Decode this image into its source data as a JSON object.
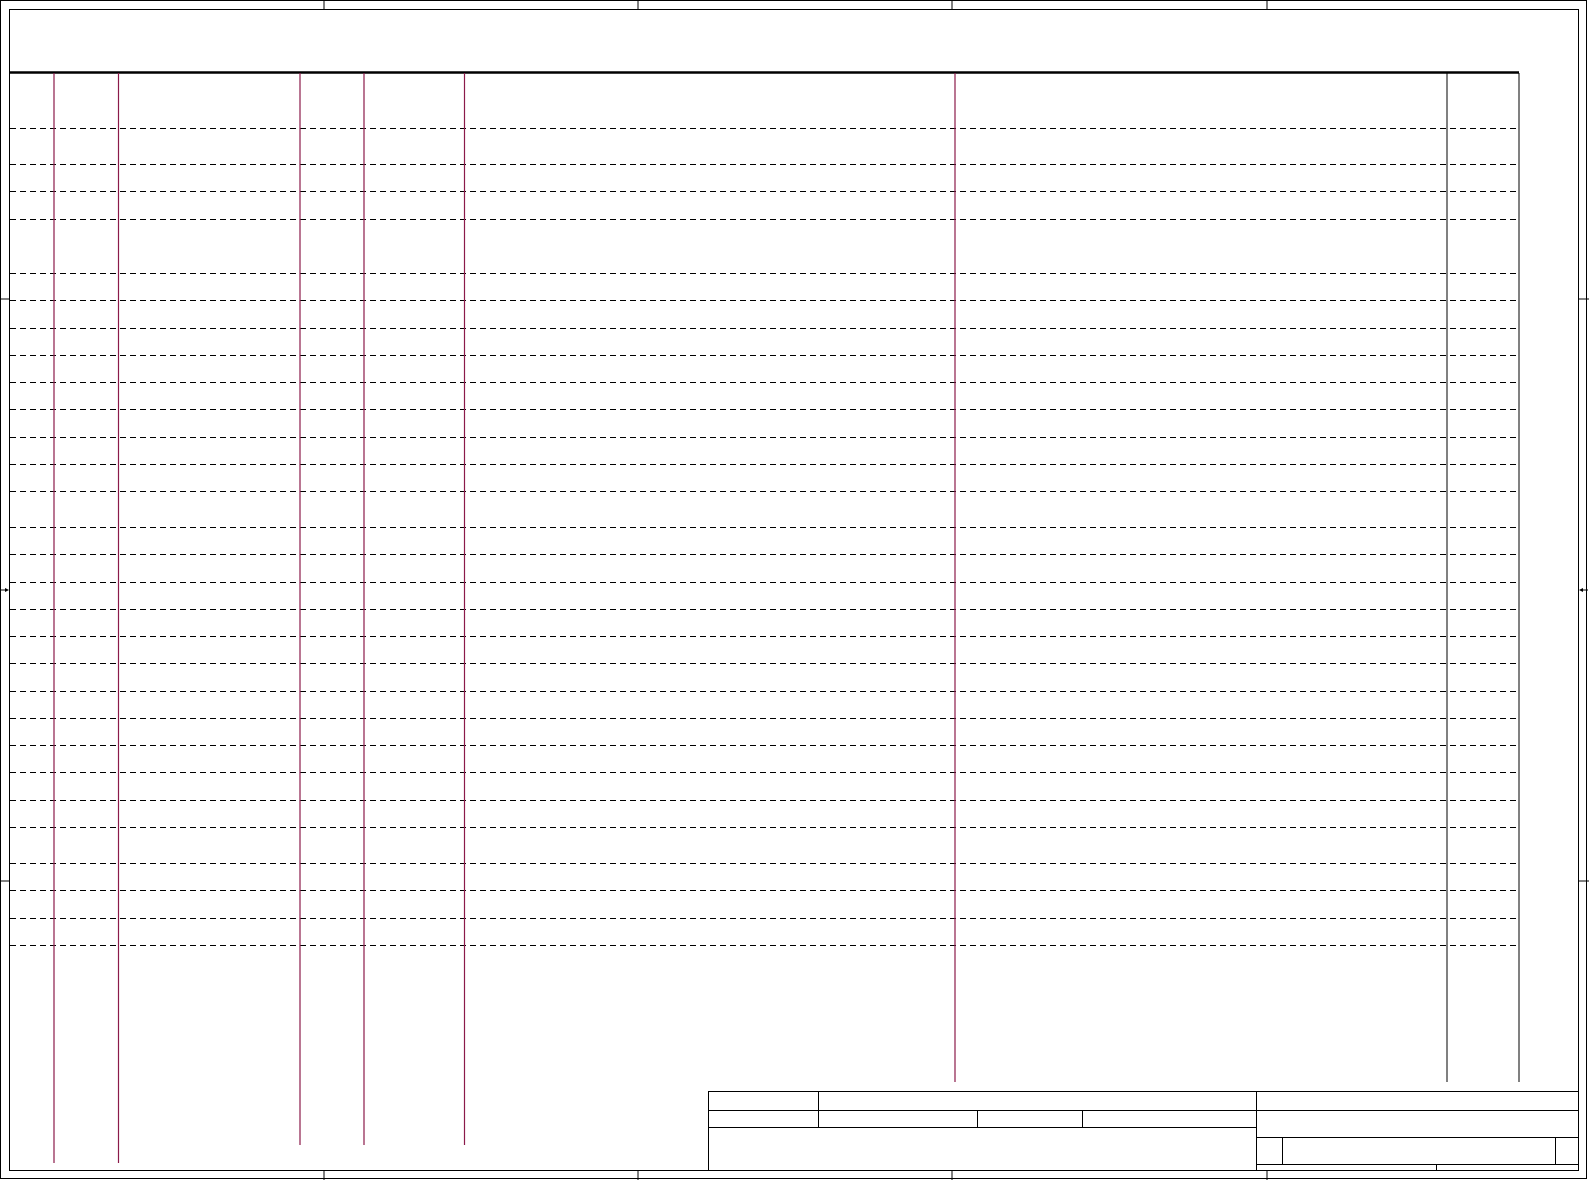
{
  "sheet": {
    "colors": {
      "frame": "#000000",
      "column_line": "#8b1a4a",
      "dash_line": "#000000",
      "background": "#ffffff"
    },
    "title_block": {
      "title": "",
      "drawing_number": "",
      "revision": "",
      "sheet": "",
      "fields": [
        "",
        "",
        "",
        "",
        "",
        "",
        ""
      ]
    },
    "table": {
      "headers": [
        "",
        "",
        "",
        "",
        "",
        "",
        ""
      ],
      "row_count": 31
    },
    "direction_markers": [
      "arrow-right-icon",
      "arrow-left-icon"
    ]
  }
}
